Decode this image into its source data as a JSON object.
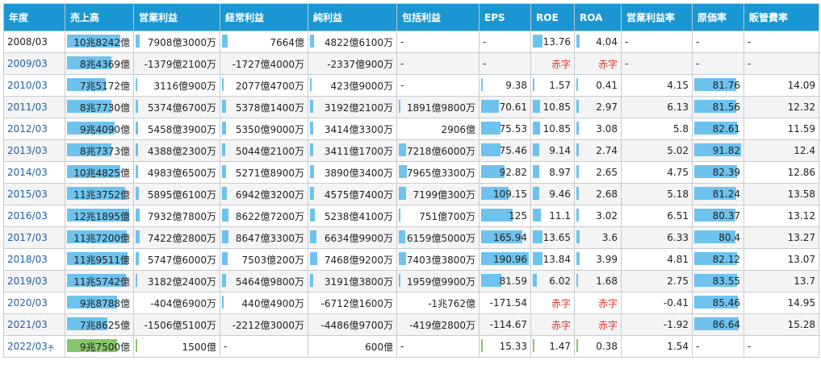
{
  "headers": [
    "年度",
    "売上高",
    "営業利益",
    "経常利益",
    "純利益",
    "包括利益",
    "EPS",
    "ROE",
    "ROA",
    "営業利益率",
    "原価率",
    "販管費率"
  ],
  "forecast_mark": "予",
  "bar_colors": {
    "actual": "#6ec2ee",
    "forecast": "#86c66c"
  },
  "rows": [
    {
      "year": "2008/03",
      "forecast": false,
      "cells": [
        {
          "t": "10兆8242億",
          "b": 0.83
        },
        {
          "t": "7908億3000万",
          "b": 0.05
        },
        {
          "t": "7664億",
          "b": 0.07
        },
        {
          "t": "4822億6100万",
          "b": 0.05
        },
        {
          "t": "-"
        },
        {
          "t": "-"
        },
        {
          "t": "13.76",
          "b": 0.24
        },
        {
          "t": "4.04",
          "b": 0.08
        },
        {
          "t": "-"
        },
        {
          "t": "-"
        },
        {
          "t": "-"
        }
      ]
    },
    {
      "year": "2009/03",
      "forecast": false,
      "cells": [
        {
          "t": "8兆4369億",
          "b": 0.69
        },
        {
          "t": "-1379億2100万"
        },
        {
          "t": "-1727億4000万"
        },
        {
          "t": "-2337億900万"
        },
        {
          "t": "-"
        },
        {
          "t": "-"
        },
        {
          "t": "赤字",
          "red": true
        },
        {
          "t": "赤字",
          "red": true
        },
        {
          "t": "-"
        },
        {
          "t": "-"
        },
        {
          "t": "-"
        }
      ]
    },
    {
      "year": "2010/03",
      "forecast": false,
      "cells": [
        {
          "t": "7兆5172億",
          "b": 0.6
        },
        {
          "t": "3116億900万",
          "b": 0.02
        },
        {
          "t": "2077億4700万",
          "b": 0.02
        },
        {
          "t": "423億9000万",
          "b": 0.01
        },
        {
          "t": "-"
        },
        {
          "t": "9.38",
          "b": 0.03
        },
        {
          "t": "1.57",
          "b": 0.03
        },
        {
          "t": "0.41",
          "b": 0.01
        },
        {
          "t": "4.15"
        },
        {
          "t": "81.76",
          "b": 0.88
        },
        {
          "t": "14.09"
        }
      ]
    },
    {
      "year": "2011/03",
      "forecast": false,
      "cells": [
        {
          "t": "8兆7730億",
          "b": 0.69
        },
        {
          "t": "5374億6700万",
          "b": 0.03
        },
        {
          "t": "5378億1400万",
          "b": 0.05
        },
        {
          "t": "3192億2100万",
          "b": 0.04
        },
        {
          "t": "1891億9800万",
          "b": 0.02
        },
        {
          "t": "70.61",
          "b": 0.38
        },
        {
          "t": "10.85",
          "b": 0.19
        },
        {
          "t": "2.97",
          "b": 0.06
        },
        {
          "t": "6.13"
        },
        {
          "t": "81.56",
          "b": 0.88
        },
        {
          "t": "12.32"
        }
      ]
    },
    {
      "year": "2012/03",
      "forecast": false,
      "cells": [
        {
          "t": "9兆4090億",
          "b": 0.74
        },
        {
          "t": "5458億3900万",
          "b": 0.03
        },
        {
          "t": "5350億9000万",
          "b": 0.05
        },
        {
          "t": "3414億3300万",
          "b": 0.04
        },
        {
          "t": "2906億"
        },
        {
          "t": "75.53",
          "b": 0.4
        },
        {
          "t": "10.85",
          "b": 0.19
        },
        {
          "t": "3.08",
          "b": 0.06
        },
        {
          "t": "5.8"
        },
        {
          "t": "82.61",
          "b": 0.89
        },
        {
          "t": "11.59"
        }
      ]
    },
    {
      "year": "2013/03",
      "forecast": false,
      "cells": [
        {
          "t": "8兆7373億",
          "b": 0.69
        },
        {
          "t": "4388億2300万",
          "b": 0.03
        },
        {
          "t": "5044億2100万",
          "b": 0.04
        },
        {
          "t": "3411億1700万",
          "b": 0.04
        },
        {
          "t": "7218億6000万",
          "b": 0.09
        },
        {
          "t": "75.46",
          "b": 0.4
        },
        {
          "t": "9.14",
          "b": 0.16
        },
        {
          "t": "2.74",
          "b": 0.05
        },
        {
          "t": "5.02"
        },
        {
          "t": "91.82",
          "b": 0.99
        },
        {
          "t": "12.4"
        }
      ]
    },
    {
      "year": "2014/03",
      "forecast": false,
      "cells": [
        {
          "t": "10兆4825億",
          "b": 0.83
        },
        {
          "t": "4983億6500万",
          "b": 0.03
        },
        {
          "t": "5271億8900万",
          "b": 0.05
        },
        {
          "t": "3890億3400万",
          "b": 0.05
        },
        {
          "t": "7965億3300万",
          "b": 0.1
        },
        {
          "t": "92.82",
          "b": 0.49
        },
        {
          "t": "8.97",
          "b": 0.16
        },
        {
          "t": "2.65",
          "b": 0.05
        },
        {
          "t": "4.75"
        },
        {
          "t": "82.39",
          "b": 0.89
        },
        {
          "t": "12.86"
        }
      ]
    },
    {
      "year": "2015/03",
      "forecast": false,
      "cells": [
        {
          "t": "11兆3752億",
          "b": 0.9
        },
        {
          "t": "5895億6100万",
          "b": 0.04
        },
        {
          "t": "6942億3200万",
          "b": 0.06
        },
        {
          "t": "4575億7400万",
          "b": 0.05
        },
        {
          "t": "7199億300万",
          "b": 0.09
        },
        {
          "t": "109.15",
          "b": 0.57
        },
        {
          "t": "9.46",
          "b": 0.17
        },
        {
          "t": "2.68",
          "b": 0.05
        },
        {
          "t": "5.18"
        },
        {
          "t": "81.24",
          "b": 0.88
        },
        {
          "t": "13.58"
        }
      ]
    },
    {
      "year": "2016/03",
      "forecast": false,
      "cells": [
        {
          "t": "12兆1895億",
          "b": 0.96
        },
        {
          "t": "7932億7800万",
          "b": 0.05
        },
        {
          "t": "8622億7200万",
          "b": 0.08
        },
        {
          "t": "5238億4100万",
          "b": 0.06
        },
        {
          "t": "751億700万",
          "b": 0.01
        },
        {
          "t": "125",
          "b": 0.66
        },
        {
          "t": "11.1",
          "b": 0.2
        },
        {
          "t": "3.02",
          "b": 0.06
        },
        {
          "t": "6.51"
        },
        {
          "t": "80.37",
          "b": 0.87
        },
        {
          "t": "13.12"
        }
      ]
    },
    {
      "year": "2017/03",
      "forecast": false,
      "cells": [
        {
          "t": "11兆7200億",
          "b": 0.93
        },
        {
          "t": "7422億2800万",
          "b": 0.05
        },
        {
          "t": "8647億3300万",
          "b": 0.08
        },
        {
          "t": "6634億9900万",
          "b": 0.08
        },
        {
          "t": "6159億5000万",
          "b": 0.08
        },
        {
          "t": "165.94",
          "b": 0.87
        },
        {
          "t": "13.65",
          "b": 0.24
        },
        {
          "t": "3.6",
          "b": 0.07
        },
        {
          "t": "6.33"
        },
        {
          "t": "80.4",
          "b": 0.87
        },
        {
          "t": "13.27"
        }
      ]
    },
    {
      "year": "2018/03",
      "forecast": false,
      "cells": [
        {
          "t": "11兆9511億",
          "b": 0.94
        },
        {
          "t": "5747億6000万",
          "b": 0.04
        },
        {
          "t": "7503億200万",
          "b": 0.07
        },
        {
          "t": "7468億9200万",
          "b": 0.09
        },
        {
          "t": "7403億3800万",
          "b": 0.09
        },
        {
          "t": "190.96",
          "b": 1.0
        },
        {
          "t": "13.84",
          "b": 0.24
        },
        {
          "t": "3.99",
          "b": 0.08
        },
        {
          "t": "4.81"
        },
        {
          "t": "82.12",
          "b": 0.89
        },
        {
          "t": "13.07"
        }
      ]
    },
    {
      "year": "2019/03",
      "forecast": false,
      "cells": [
        {
          "t": "11兆5742億",
          "b": 0.91
        },
        {
          "t": "3182億2400万",
          "b": 0.02
        },
        {
          "t": "5464億9800万",
          "b": 0.05
        },
        {
          "t": "3191億3800万",
          "b": 0.04
        },
        {
          "t": "1959億9900万",
          "b": 0.02
        },
        {
          "t": "81.59",
          "b": 0.43
        },
        {
          "t": "6.02",
          "b": 0.11
        },
        {
          "t": "1.68",
          "b": 0.03
        },
        {
          "t": "2.75"
        },
        {
          "t": "83.55",
          "b": 0.9
        },
        {
          "t": "13.7"
        }
      ]
    },
    {
      "year": "2020/03",
      "forecast": false,
      "cells": [
        {
          "t": "9兆8788億",
          "b": 0.78
        },
        {
          "t": "-404億6900万"
        },
        {
          "t": "440億4900万",
          "b": 0.01
        },
        {
          "t": "-6712億1600万"
        },
        {
          "t": "-1兆762億"
        },
        {
          "t": "-171.54"
        },
        {
          "t": "赤字",
          "red": true
        },
        {
          "t": "赤字",
          "red": true
        },
        {
          "t": "-0.41"
        },
        {
          "t": "85.46",
          "b": 0.92
        },
        {
          "t": "14.95"
        }
      ]
    },
    {
      "year": "2021/03",
      "forecast": false,
      "cells": [
        {
          "t": "7兆8625億",
          "b": 0.62
        },
        {
          "t": "-1506億5100万"
        },
        {
          "t": "-2212億3000万"
        },
        {
          "t": "-4486億9700万"
        },
        {
          "t": "-419億2800万"
        },
        {
          "t": "-114.67"
        },
        {
          "t": "赤字",
          "red": true
        },
        {
          "t": "赤字",
          "red": true
        },
        {
          "t": "-1.92"
        },
        {
          "t": "86.64",
          "b": 0.94
        },
        {
          "t": "15.28"
        }
      ]
    },
    {
      "year": "2022/03",
      "forecast": true,
      "cells": [
        {
          "t": "9兆7500億",
          "b": 0.77
        },
        {
          "t": "1500億",
          "b": 0.01
        },
        {
          "t": "-",
          "left": true
        },
        {
          "t": "600億"
        },
        {
          "t": "-"
        },
        {
          "t": "15.33",
          "b": 0.04
        },
        {
          "t": "1.47",
          "b": 0.03
        },
        {
          "t": "0.38",
          "b": 0.01
        },
        {
          "t": "1.54"
        },
        {
          "t": "-"
        },
        {
          "t": "-"
        }
      ]
    }
  ]
}
